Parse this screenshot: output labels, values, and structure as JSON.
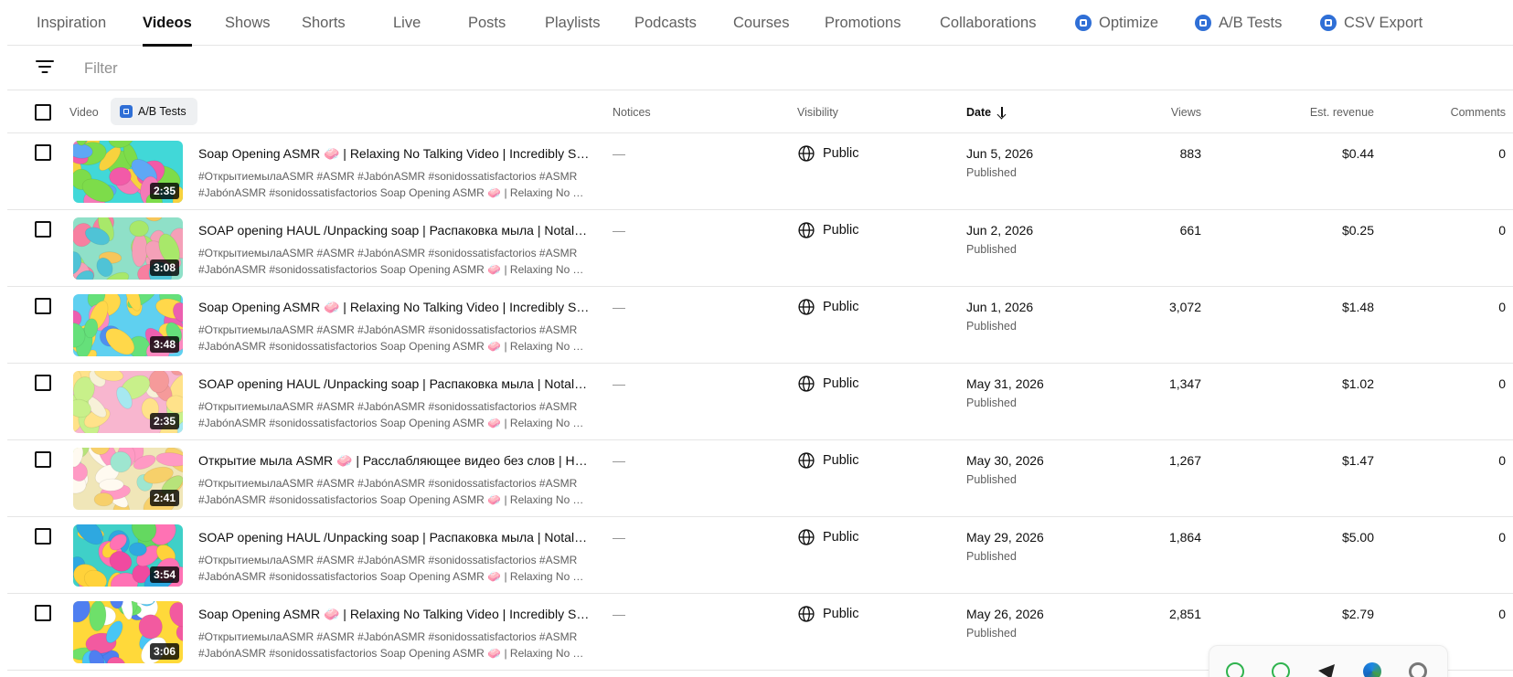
{
  "tabs": [
    {
      "label": "Inspiration",
      "active": false
    },
    {
      "label": "Videos",
      "active": true
    },
    {
      "label": "Shows",
      "active": false
    },
    {
      "label": "Shorts",
      "active": false
    },
    {
      "label": "Live",
      "active": false
    },
    {
      "label": "Posts",
      "active": false
    },
    {
      "label": "Playlists",
      "active": false
    },
    {
      "label": "Podcasts",
      "active": false
    },
    {
      "label": "Courses",
      "active": false
    },
    {
      "label": "Promotions",
      "active": false
    },
    {
      "label": "Collaborations",
      "active": false
    },
    {
      "label": "Optimize",
      "active": false,
      "extension_icon": true
    },
    {
      "label": "A/B Tests",
      "active": false,
      "extension_icon": true
    },
    {
      "label": "CSV Export",
      "active": false,
      "extension_icon": true
    }
  ],
  "filter": {
    "placeholder": "Filter",
    "icon": "filter-lines-icon"
  },
  "table": {
    "headers": {
      "video": "Video",
      "ab_tests": "A/B Tests",
      "notices": "Notices",
      "visibility": "Visibility",
      "date": "Date",
      "views": "Views",
      "revenue": "Est. revenue",
      "comments": "Comments"
    },
    "sort": {
      "column": "date",
      "direction": "descending"
    },
    "rows": [
      {
        "duration": "2:35",
        "title": "Soap Opening ASMR 🧼 | Relaxing No Talking Video | Incredibly Satisfying",
        "desc1": "#ОткрытиемылаASMR #ASMR #JabónASMR #sonidossatisfactorios #ASMR",
        "desc2": "#JabónASMR #sonidossatisfactorios Soap Opening ASMR 🧼 | Relaxing No Talking",
        "notice": "—",
        "visibility": "Public",
        "date": "Jun 5, 2026",
        "status": "Published",
        "views": "883",
        "revenue": "$0.44",
        "comments": "0"
      },
      {
        "duration": "3:08",
        "title": "SOAP opening HAUL /Unpacking soap | Распаковка мыла | Notalking",
        "desc1": "#ОткрытиемылаASMR #ASMR #JabónASMR #sonidossatisfactorios #ASMR",
        "desc2": "#JabónASMR #sonidossatisfactorios Soap Opening ASMR 🧼 | Relaxing No Talking",
        "notice": "—",
        "visibility": "Public",
        "date": "Jun 2, 2026",
        "status": "Published",
        "views": "661",
        "revenue": "$0.25",
        "comments": "0"
      },
      {
        "duration": "3:48",
        "title": "Soap Opening ASMR 🧼 | Relaxing No Talking Video | Incredibly Satisfying",
        "desc1": "#ОткрытиемылаASMR #ASMR #JabónASMR #sonidossatisfactorios #ASMR",
        "desc2": "#JabónASMR #sonidossatisfactorios Soap Opening ASMR 🧼 | Relaxing No Talking",
        "notice": "—",
        "visibility": "Public",
        "date": "Jun 1, 2026",
        "status": "Published",
        "views": "3,072",
        "revenue": "$1.48",
        "comments": "0"
      },
      {
        "duration": "2:35",
        "title": "SOAP opening HAUL /Unpacking soap | Распаковка мыла | Notalking",
        "desc1": "#ОткрытиемылаASMR #ASMR #JabónASMR #sonidossatisfactorios #ASMR",
        "desc2": "#JabónASMR #sonidossatisfactorios Soap Opening ASMR 🧼 | Relaxing No Talking",
        "notice": "—",
        "visibility": "Public",
        "date": "May 31, 2026",
        "status": "Published",
        "views": "1,347",
        "revenue": "$1.02",
        "comments": "0"
      },
      {
        "duration": "2:41",
        "title": "Открытие мыла ASMR 🧼 | Расслабляющее видео без слов | Невероятно",
        "desc1": "#ОткрытиемылаASMR #ASMR #JabónASMR #sonidossatisfactorios #ASMR",
        "desc2": "#JabónASMR #sonidossatisfactorios Soap Opening ASMR 🧼 | Relaxing No Talking",
        "notice": "—",
        "visibility": "Public",
        "date": "May 30, 2026",
        "status": "Published",
        "views": "1,267",
        "revenue": "$1.47",
        "comments": "0"
      },
      {
        "duration": "3:54",
        "title": "SOAP opening HAUL /Unpacking soap | Распаковка мыла | Notalking",
        "desc1": "#ОткрытиемылаASMR #ASMR #JabónASMR #sonidossatisfactorios #ASMR",
        "desc2": "#JabónASMR #sonidossatisfactorios Soap Opening ASMR 🧼 | Relaxing No Talking",
        "notice": "—",
        "visibility": "Public",
        "date": "May 29, 2026",
        "status": "Published",
        "views": "1,864",
        "revenue": "$5.00",
        "comments": "0"
      },
      {
        "duration": "3:06",
        "title": "Soap Opening ASMR 🧼 | Relaxing No Talking Video | Incredibly Satisfying",
        "desc1": "#ОткрытиемылаASMR #ASMR #JabónASMR #sonidossatisfactorios #ASMR",
        "desc2": "#JabónASMR #sonidossatisfactorios Soap Opening ASMR 🧼 | Relaxing No Talking",
        "notice": "—",
        "visibility": "Public",
        "date": "May 26, 2026",
        "status": "Published",
        "views": "2,851",
        "revenue": "$2.79",
        "comments": "0"
      }
    ]
  },
  "floating_toolbar": {
    "icons": [
      "whatsapp-icon",
      "whatsapp-business-icon",
      "telegram-icon",
      "edge-icon",
      "settings-icon"
    ]
  },
  "colors": {
    "accent": "#2f6fd6",
    "text": "#0f0f0f",
    "muted": "#606060",
    "divider": "#e5e5e5",
    "chip_bg": "#eef0f2"
  }
}
